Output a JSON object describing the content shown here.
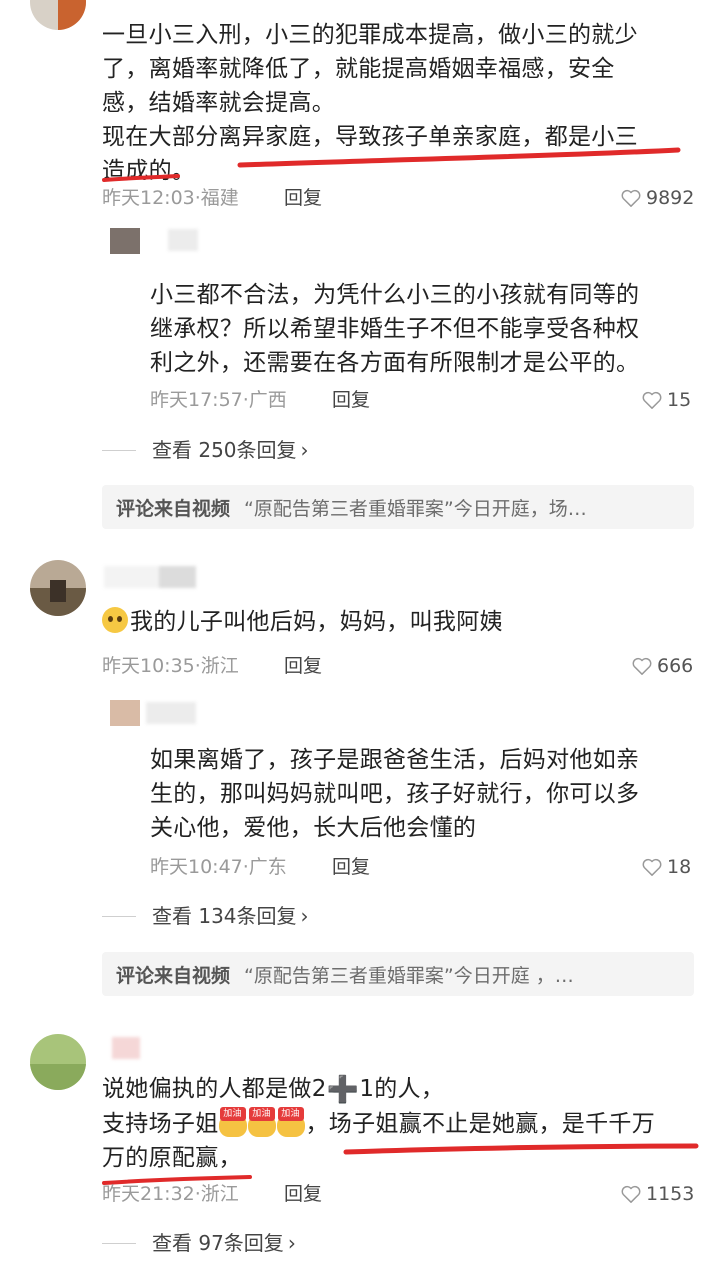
{
  "comments": [
    {
      "text_lines": [
        "一旦小三入刑，小三的犯罪成本提高，做小三的就少",
        "了，离婚率就降低了，就能提高婚姻幸福感，安全",
        "感，结婚率就会提高。",
        "现在大部分离异家庭，导致孩子单亲家庭，都是小三",
        "造成的。"
      ],
      "time_location": "昨天12:03·福建",
      "reply_label": "回复",
      "likes": "9892",
      "reply": {
        "text_lines": [
          "小三都不合法，为凭什么小三的小孩就有同等的",
          "继承权？所以希望非婚生子不但不能享受各种权",
          "利之外，还需要在各方面有所限制才是公平的。"
        ],
        "time_location": "昨天17:57·广西",
        "reply_label": "回复",
        "likes": "15"
      },
      "view_more": "查看 250条回复",
      "source_label": "评论来自视频",
      "source_text": "“原配告第三者重婚罪案”今日开庭，场…"
    },
    {
      "text_lines": [
        "我的儿子叫他后妈，妈妈，叫我阿姨"
      ],
      "time_location": "昨天10:35·浙江",
      "reply_label": "回复",
      "likes": "666",
      "reply": {
        "text_lines": [
          "如果离婚了，孩子是跟爸爸生活，后妈对他如亲",
          "生的，那叫妈妈就叫吧，孩子好就行，你可以多",
          "关心他，爱他，长大后他会懂的"
        ],
        "time_location": "昨天10:47·广东",
        "reply_label": "回复",
        "likes": "18"
      },
      "view_more": "查看 134条回复",
      "source_label": "评论来自视频",
      "source_text": "“原配告第三者重婚罪案”今日开庭 ，…"
    },
    {
      "line1_a": "说她偏执的人都是做2",
      "line1_b": "1的人，",
      "line2_a": "支持场子姐",
      "line2_b": "，场子姐赢不止是她赢，是千千万",
      "line3": "万的原配赢，",
      "emoji_tag": "加油",
      "time_location": "昨天21:32·浙江",
      "reply_label": "回复",
      "likes": "1153",
      "view_more": "查看 97条回复"
    }
  ],
  "colors": {
    "accent_underline": "#e02a2a",
    "meta_gray": "#9a9a9a",
    "source_bg": "#f4f4f4"
  },
  "icons": [
    "heart-outline-icon",
    "chevron-right-icon",
    "crying-face-emoji",
    "plus-emoji",
    "cheer-emoji"
  ]
}
